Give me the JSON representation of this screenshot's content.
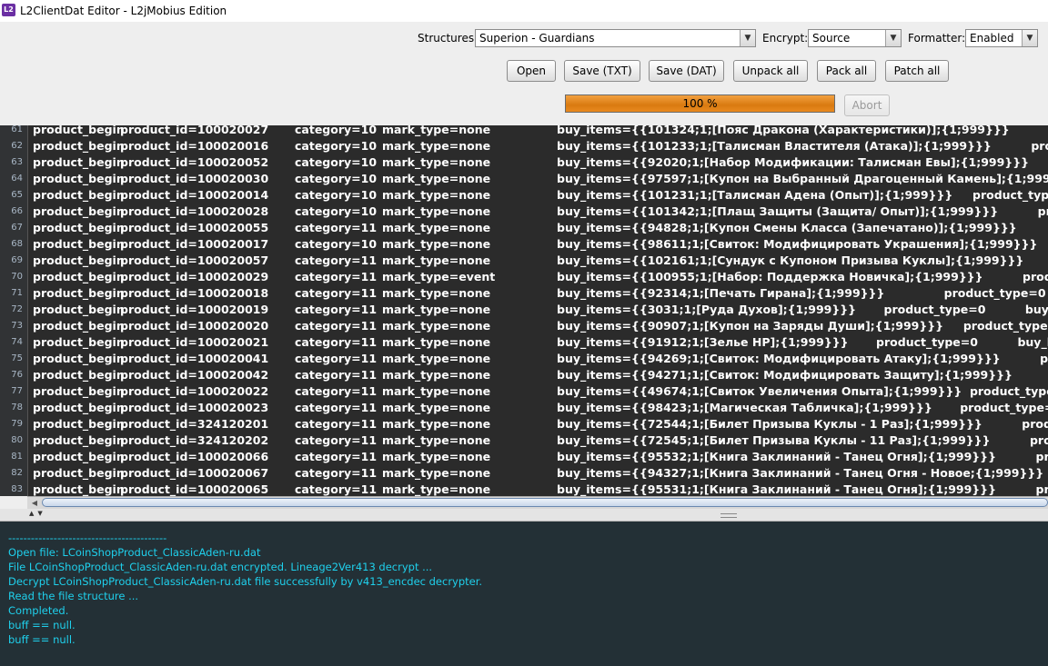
{
  "window": {
    "title": "L2ClientDat Editor - L2jMobius Edition",
    "icon_text": "L2"
  },
  "toolbar": {
    "structures_label": "Structures",
    "structures_value": "Superion - Guardians",
    "encrypt_label": "Encrypt:",
    "encrypt_value": "Source",
    "formatter_label": "Formatter:",
    "formatter_value": "Enabled",
    "buttons": {
      "open": "Open",
      "save_txt": "Save (TXT)",
      "save_dat": "Save (DAT)",
      "unpack_all": "Unpack all",
      "pack_all": "Pack all",
      "patch_all": "Patch all",
      "abort": "Abort"
    },
    "progress_text": "100 %",
    "progress_value": 100
  },
  "editor": {
    "lines": [
      {
        "n": "61",
        "a": "product_begin",
        "b": "product_id=100020027",
        "c": "category=10",
        "d": "mark_type=none",
        "e": "buy_items={{101324;1;[Пояс Дракона (Характеристики)];{1;999}}}          product_t"
      },
      {
        "n": "62",
        "a": "product_begin",
        "b": "product_id=100020016",
        "c": "category=10",
        "d": "mark_type=none",
        "e": "buy_items={{101233;1;[Талисман Властителя (Атака)];{1;999}}}          product_t"
      },
      {
        "n": "63",
        "a": "product_begin",
        "b": "product_id=100020052",
        "c": "category=10",
        "d": "mark_type=none",
        "e": "buy_items={{92020;1;[Набор Модификации: Талисман Евы];{1;999}}}          product_t"
      },
      {
        "n": "64",
        "a": "product_begin",
        "b": "product_id=100020030",
        "c": "category=10",
        "d": "mark_type=none",
        "e": "buy_items={{97597;1;[Купон на Выбранный Драгоценный Камень];{1;999}}}"
      },
      {
        "n": "65",
        "a": "product_begin",
        "b": "product_id=100020014",
        "c": "category=10",
        "d": "mark_type=none",
        "e": "buy_items={{101231;1;[Талисман Адена (Опыт)];{1;999}}}     product_type=0"
      },
      {
        "n": "66",
        "a": "product_begin",
        "b": "product_id=100020028",
        "c": "category=10",
        "d": "mark_type=none",
        "e": "buy_items={{101342;1;[Плащ Защиты (Защита/ Опыт)];{1;999}}}          product_t"
      },
      {
        "n": "67",
        "a": "product_begin",
        "b": "product_id=100020055",
        "c": "category=11",
        "d": "mark_type=none",
        "e": "buy_items={{94828;1;[Купон Смены Класса (Запечатано)];{1;999}}}          product_t"
      },
      {
        "n": "68",
        "a": "product_begin",
        "b": "product_id=100020017",
        "c": "category=10",
        "d": "mark_type=none",
        "e": "buy_items={{98611;1;[Свиток: Модифицировать Украшения];{1;999}}}          product_t"
      },
      {
        "n": "69",
        "a": "product_begin",
        "b": "product_id=100020057",
        "c": "category=11",
        "d": "mark_type=none",
        "e": "buy_items={{102161;1;[Сундук с Купоном Призыва Куклы];{1;999}}}          product_t"
      },
      {
        "n": "70",
        "a": "product_begin",
        "b": "product_id=100020029",
        "c": "category=11",
        "d": "mark_type=event",
        "e": "buy_items={{100955;1;[Набор: Поддержка Новичка];{1;999}}}          product_t"
      },
      {
        "n": "71",
        "a": "product_begin",
        "b": "product_id=100020018",
        "c": "category=11",
        "d": "mark_type=none",
        "e": "buy_items={{92314;1;[Печать Гирана];{1;999}}}               product_type=0"
      },
      {
        "n": "72",
        "a": "product_begin",
        "b": "product_id=100020019",
        "c": "category=11",
        "d": "mark_type=none",
        "e": "buy_items={{3031;1;[Руда Духов];{1;999}}}       product_type=0          buy_limit="
      },
      {
        "n": "73",
        "a": "product_begin",
        "b": "product_id=100020020",
        "c": "category=11",
        "d": "mark_type=none",
        "e": "buy_items={{90907;1;[Купон на Заряды Души];{1;999}}}     product_type=0"
      },
      {
        "n": "74",
        "a": "product_begin",
        "b": "product_id=100020021",
        "c": "category=11",
        "d": "mark_type=none",
        "e": "buy_items={{91912;1;[Зелье HP];{1;999}}}       product_type=0          buy_limit="
      },
      {
        "n": "75",
        "a": "product_begin",
        "b": "product_id=100020041",
        "c": "category=11",
        "d": "mark_type=none",
        "e": "buy_items={{94269;1;[Свиток: Модифицировать Атаку];{1;999}}}          product_t"
      },
      {
        "n": "76",
        "a": "product_begin",
        "b": "product_id=100020042",
        "c": "category=11",
        "d": "mark_type=none",
        "e": "buy_items={{94271;1;[Свиток: Модифицировать Защиту];{1;999}}}          product_t"
      },
      {
        "n": "77",
        "a": "product_begin",
        "b": "product_id=100020022",
        "c": "category=11",
        "d": "mark_type=none",
        "e": "buy_items={{49674;1;[Свиток Увеличения Опыта];{1;999}}}  product_type=0"
      },
      {
        "n": "78",
        "a": "product_begin",
        "b": "product_id=100020023",
        "c": "category=11",
        "d": "mark_type=none",
        "e": "buy_items={{98423;1;[Магическая Табличка];{1;999}}}       product_type=1"
      },
      {
        "n": "79",
        "a": "product_begin",
        "b": "product_id=324120201",
        "c": "category=11",
        "d": "mark_type=none",
        "e": "buy_items={{72544;1;[Билет Призыва Куклы - 1 Раз];{1;999}}}          product_t"
      },
      {
        "n": "80",
        "a": "product_begin",
        "b": "product_id=324120202",
        "c": "category=11",
        "d": "mark_type=none",
        "e": "buy_items={{72545;1;[Билет Призыва Куклы - 11 Раз];{1;999}}}          product_t"
      },
      {
        "n": "81",
        "a": "product_begin",
        "b": "product_id=100020066",
        "c": "category=11",
        "d": "mark_type=none",
        "e": "buy_items={{95532;1;[Книга Заклинаний - Танец Огня];{1;999}}}          product_t"
      },
      {
        "n": "82",
        "a": "product_begin",
        "b": "product_id=100020067",
        "c": "category=11",
        "d": "mark_type=none",
        "e": "buy_items={{94327;1;[Книга Заклинаний - Танец Огня - Новое;{1;999}}}          product_t"
      },
      {
        "n": "83",
        "a": "product_begin",
        "b": "product_id=100020065",
        "c": "category=11",
        "d": "mark_type=none",
        "e": "buy_items={{95531;1;[Книга Заклинаний - Танец Огня];{1;999}}}          product_t"
      },
      {
        "n": "84",
        "a": "product_begin",
        "b": "product_id=100020066",
        "c": "category=11",
        "d": "mark_type=none",
        "e": "buy_items={{95532;1;[Книга Заклинаний - Танец Огня];{1;999}}}          product_t"
      }
    ]
  },
  "console": {
    "lines": [
      "------------------------------------------",
      "Open file: LCoinShopProduct_ClassicAden-ru.dat",
      "File LCoinShopProduct_ClassicAden-ru.dat encrypted. Lineage2Ver413 decrypt ...",
      "Decrypt LCoinShopProduct_ClassicAden-ru.dat file successfully by v413_encdec decrypter.",
      "Read the file structure ...",
      "Completed.",
      "buff == null.",
      "buff == null."
    ]
  }
}
